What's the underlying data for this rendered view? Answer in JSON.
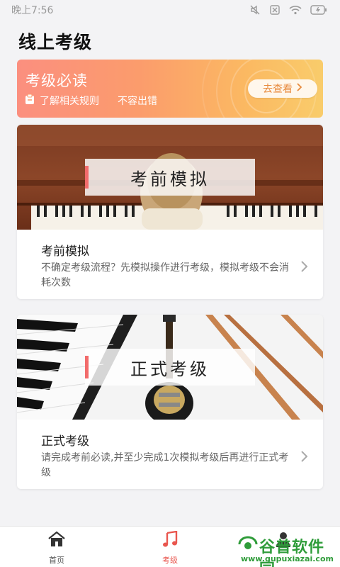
{
  "status_bar": {
    "time": "晚上7:56",
    "icons": [
      "mute-icon",
      "sim-off-icon",
      "wifi-icon",
      "battery-charging-icon"
    ]
  },
  "page": {
    "title": "线上考级"
  },
  "banner": {
    "title": "考级必读",
    "subtitle_1": "了解相关规则",
    "subtitle_2": "不容出错",
    "button_label": "去查看",
    "icon": "clipboard-icon"
  },
  "cards": [
    {
      "overlay_label": "考前模拟",
      "title": "考前模拟",
      "description": "不确定考级流程？先模拟操作进行考级，模拟考级不会消耗次数",
      "image": "piano-child-photo"
    },
    {
      "overlay_label": "正式考级",
      "title": "正式考级",
      "description": "请完成考前必读,并至少完成1次模拟考级后再进行正式考级",
      "image": "keyboard-guitar-drumsticks-photo"
    }
  ],
  "bottom_nav": {
    "items": [
      {
        "label": "首页",
        "icon": "home-icon",
        "active": false
      },
      {
        "label": "考级",
        "icon": "music-note-icon",
        "active": true
      },
      {
        "label": "",
        "icon": "person-icon",
        "active": false
      }
    ]
  },
  "watermark": {
    "text": "谷普软件园",
    "url": "www.gupuxiazai.com"
  },
  "colors": {
    "accent": "#e9564e",
    "banner_start": "#fb8f7f",
    "banner_end": "#f9cc6b",
    "overlay_bar": "#f26b6b",
    "watermark_green": "#2f9c3a"
  }
}
